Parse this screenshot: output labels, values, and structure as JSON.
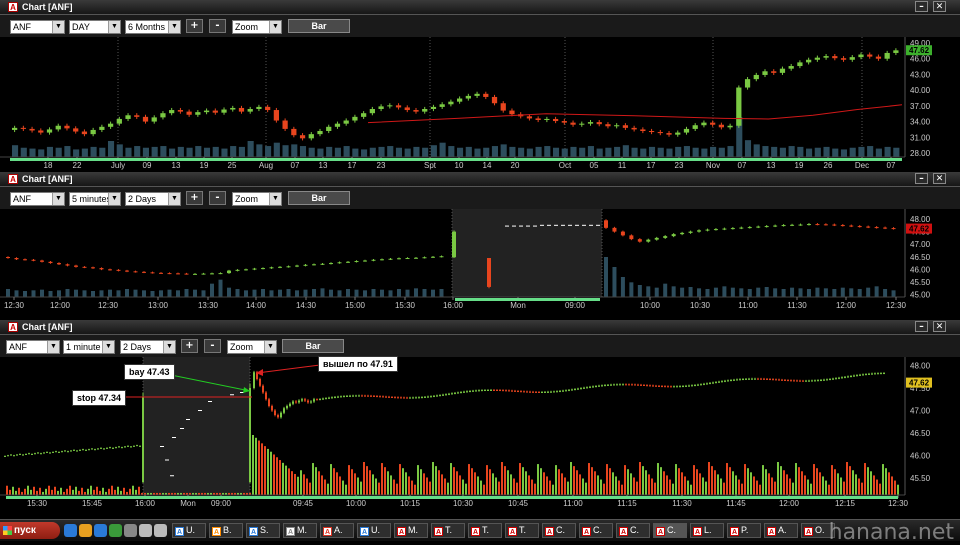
{
  "windows": [
    {
      "title": "Chart [ANF]",
      "symbol": "ANF",
      "interval": "DAY",
      "range": "6 Months",
      "mode": "Zoom",
      "plus": "+",
      "minus": "-",
      "bar_label": "Bar",
      "chart_data": {
        "type": "candlestick",
        "x_labels": [
          "18",
          "22",
          "July",
          "09",
          "13",
          "19",
          "25",
          "Aug",
          "07",
          "13",
          "17",
          "23",
          "Spt",
          "10",
          "14",
          "20",
          "Oct",
          "05",
          "11",
          "17",
          "23",
          "Nov",
          "07",
          "13",
          "19",
          "26",
          "Dec",
          "07"
        ],
        "y_ticks": [
          "49.00",
          "46.00",
          "43.00",
          "40.00",
          "37.00",
          "34.00",
          "31.00",
          "28.00"
        ],
        "ylim": [
          28,
          49
        ],
        "last_price": "47.62",
        "last_color": "#3cb02c",
        "closes": [
          32.8,
          32.6,
          32.3,
          31.9,
          32.5,
          33.2,
          32.7,
          32.1,
          31.6,
          32.4,
          33.0,
          33.6,
          34.5,
          35.2,
          34.9,
          34.0,
          34.8,
          35.6,
          36.2,
          35.9,
          35.3,
          35.8,
          36.1,
          35.7,
          36.3,
          36.6,
          35.9,
          36.4,
          36.8,
          36.2,
          34.2,
          32.6,
          31.4,
          30.8,
          31.6,
          32.2,
          33.0,
          33.6,
          34.2,
          34.9,
          35.6,
          36.4,
          36.9,
          37.1,
          36.7,
          36.2,
          35.9,
          36.4,
          36.8,
          37.3,
          37.8,
          38.4,
          38.9,
          39.3,
          38.7,
          37.5,
          36.1,
          35.4,
          35.0,
          34.6,
          34.3,
          34.5,
          34.1,
          33.8,
          33.4,
          33.6,
          33.9,
          33.5,
          33.1,
          33.3,
          32.8,
          32.5,
          32.2,
          32.0,
          31.8,
          31.5,
          31.9,
          32.6,
          33.3,
          33.8,
          33.4,
          32.9,
          33.2,
          40.5,
          42.1,
          42.9,
          43.6,
          43.3,
          44.1,
          44.6,
          45.3,
          45.8,
          46.2,
          46.5,
          46.1,
          45.8,
          46.3,
          46.8,
          46.4,
          46.0,
          47.1,
          47.6
        ],
        "sma": [
          [
            0.4,
            33.8
          ],
          [
            0.5,
            34.6
          ],
          [
            0.6,
            35.5
          ],
          [
            0.7,
            35.1
          ],
          [
            0.8,
            34.6
          ],
          [
            0.85,
            34.5
          ],
          [
            0.9,
            35.2
          ],
          [
            0.95,
            36.3
          ],
          [
            1.0,
            37.2
          ]
        ],
        "volumes": [
          28,
          22,
          20,
          18,
          24,
          22,
          26,
          18,
          20,
          24,
          22,
          38,
          30,
          22,
          26,
          22,
          24,
          26,
          20,
          24,
          22,
          26,
          22,
          24,
          20,
          26,
          24,
          38,
          30,
          26,
          34,
          28,
          30,
          26,
          22,
          20,
          24,
          22,
          26,
          20,
          18,
          22,
          24,
          26,
          22,
          20,
          24,
          22,
          28,
          34,
          26,
          22,
          24,
          20,
          22,
          26,
          30,
          24,
          22,
          20,
          24,
          26,
          22,
          20,
          24,
          22,
          26,
          20,
          22,
          24,
          28,
          22,
          20,
          24,
          22,
          20,
          24,
          26,
          22,
          20,
          24,
          22,
          26,
          95,
          40,
          30,
          26,
          24,
          22,
          26,
          24,
          20,
          22,
          24,
          20,
          18,
          22,
          24,
          26,
          20,
          24,
          22
        ],
        "volume_color": "#2d4d5d"
      }
    },
    {
      "title": "Chart [ANF]",
      "symbol": "ANF",
      "interval": "5 minutes",
      "range": "2 Days",
      "mode": "Zoom",
      "plus": "+",
      "minus": "-",
      "bar_label": "Bar",
      "chart_data": {
        "type": "candlestick",
        "x_labels": [
          "12:30",
          "12:00",
          "12:30",
          "13:00",
          "13:30",
          "14:00",
          "14:30",
          "15:00",
          "15:30",
          "16:00",
          "Mon",
          "09:00",
          "10:00",
          "10:30",
          "11:00",
          "11:30",
          "12:00",
          "12:30"
        ],
        "y_ticks": [
          "48.00",
          "47.50",
          "47.00",
          "46.50",
          "46.00",
          "45.50",
          "45.00"
        ],
        "ylim": [
          44.9,
          48.2
        ],
        "last_price": "47.62",
        "last_color": "#d01010",
        "closes": [
          46.45,
          46.4,
          46.38,
          46.35,
          46.3,
          46.25,
          46.2,
          46.15,
          46.1,
          46.08,
          46.05,
          46.0,
          45.98,
          45.95,
          45.92,
          45.9,
          45.88,
          45.86,
          45.85,
          45.84,
          45.83,
          45.82,
          45.82,
          45.83,
          45.84,
          45.85,
          45.95,
          45.98,
          46.0,
          46.03,
          46.05,
          46.08,
          46.1,
          46.12,
          46.15,
          46.18,
          46.2,
          46.22,
          46.25,
          46.28,
          46.3,
          46.33,
          46.35,
          46.38,
          46.4,
          46.42,
          46.44,
          46.45,
          46.46,
          46.48,
          46.5,
          46.52
        ],
        "closes_after": [
          47.65,
          47.5,
          47.35,
          47.2,
          47.1,
          47.18,
          47.25,
          47.32,
          47.4,
          47.45,
          47.5,
          47.55,
          47.58,
          47.6,
          47.62,
          47.64,
          47.66,
          47.68,
          47.7,
          47.72,
          47.74,
          47.76,
          47.77,
          47.78,
          47.8,
          47.79,
          47.78,
          47.76,
          47.74,
          47.72,
          47.7,
          47.68,
          47.66,
          47.64,
          47.62
        ],
        "volumes": [
          12,
          10,
          9,
          10,
          11,
          9,
          10,
          12,
          11,
          10,
          9,
          10,
          11,
          10,
          12,
          11,
          10,
          9,
          10,
          11,
          10,
          12,
          11,
          10,
          20,
          26,
          14,
          12,
          10,
          11,
          12,
          10,
          11,
          12,
          10,
          11,
          12,
          13,
          11,
          10,
          12,
          11,
          10,
          12,
          11,
          10,
          12,
          11,
          13,
          12,
          11,
          12
        ],
        "volumes_after": [
          60,
          45,
          30,
          22,
          18,
          16,
          14,
          20,
          16,
          14,
          15,
          13,
          12,
          14,
          16,
          14,
          13,
          12,
          14,
          15,
          13,
          12,
          14,
          13,
          12,
          14,
          13,
          12,
          14,
          13,
          12,
          14,
          16,
          12,
          10
        ],
        "volume_color": "#2d4d5d"
      }
    },
    {
      "title": "Chart [ANF]",
      "symbol": "ANF",
      "interval": "1 minute",
      "range": "2 Days",
      "mode": "Zoom",
      "plus": "+",
      "minus": "-",
      "bar_label": "Bar",
      "chart_data": {
        "type": "candlestick",
        "x_labels": [
          "15:30",
          "15:45",
          "16:00",
          "Mon",
          "09:00",
          "09:45",
          "10:00",
          "10:15",
          "10:30",
          "10:45",
          "11:00",
          "11:15",
          "11:30",
          "11:45",
          "12:00",
          "12:15",
          "12:30"
        ],
        "y_ticks": [
          "48.00",
          "47.50",
          "47.00",
          "46.50",
          "46.00",
          "45.50"
        ],
        "ylim": [
          45.3,
          48.1
        ],
        "last_price": "47.62",
        "last_color": "#e0c020",
        "annotations": {
          "buy": "bay 47.43",
          "stop": "stop 47.34",
          "exit": "вышел по 47.91"
        }
      }
    }
  ],
  "taskbar": {
    "start_label": "пуск",
    "quicklaunch": [
      "ie-icon",
      "outlook-icon",
      "media-icon",
      "chrome-icon",
      "app-icon-1",
      "app-icon-2",
      "app-icon-3"
    ],
    "items": [
      {
        "label": "U.",
        "color": "#2a7ad8"
      },
      {
        "label": "B.",
        "color": "#ff8c00"
      },
      {
        "label": "S.",
        "color": "#2a7ad8"
      },
      {
        "label": "M.",
        "color": "#888"
      },
      {
        "label": "A.",
        "color": "#d32"
      },
      {
        "label": "U.",
        "color": "#2a7ad8"
      },
      {
        "label": "M.",
        "color": "#c00"
      },
      {
        "label": "T.",
        "color": "#c00"
      },
      {
        "label": "T.",
        "color": "#c00"
      },
      {
        "label": "T.",
        "color": "#c00"
      },
      {
        "label": "C.",
        "color": "#c00"
      },
      {
        "label": "C.",
        "color": "#c00"
      },
      {
        "label": "C.",
        "color": "#c00"
      },
      {
        "label": "C.",
        "color": "#c00"
      },
      {
        "label": "L.",
        "color": "#c00"
      },
      {
        "label": "P.",
        "color": "#c00"
      },
      {
        "label": "A.",
        "color": "#c00"
      },
      {
        "label": "O.",
        "color": "#c00"
      }
    ],
    "watermark": "hanana.net"
  }
}
